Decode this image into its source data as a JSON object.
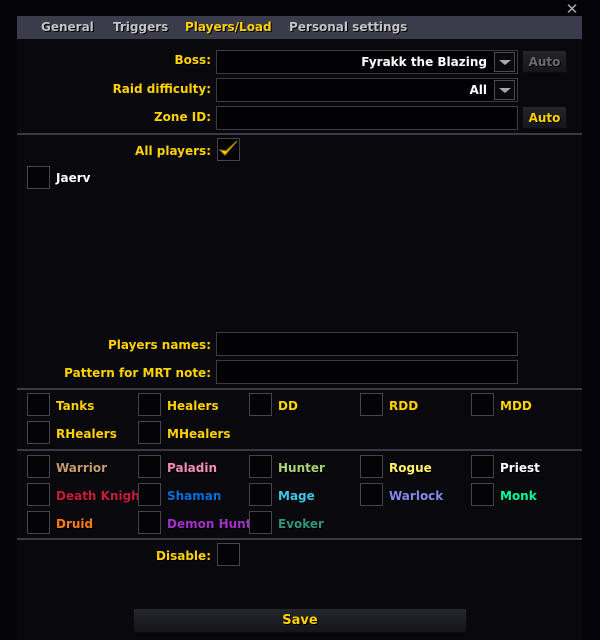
{
  "window": {
    "close_icon": "✕"
  },
  "tabs": [
    {
      "label": "General",
      "active": false
    },
    {
      "label": "Triggers",
      "active": false
    },
    {
      "label": "Players/Load",
      "active": true
    },
    {
      "label": "Personal settings",
      "active": false
    }
  ],
  "boss": {
    "label": "Boss:",
    "value": "Fyrakk the Blazing",
    "auto_label": "Auto",
    "auto_enabled": false
  },
  "difficulty": {
    "label": "Raid difficulty:",
    "value": "All"
  },
  "zone": {
    "label": "Zone ID:",
    "value": "",
    "auto_label": "Auto",
    "auto_enabled": true
  },
  "all_players": {
    "label": "All players:",
    "checked": true
  },
  "players": [
    {
      "name": "Jaerv",
      "checked": false
    }
  ],
  "players_names": {
    "label": "Players names:",
    "value": ""
  },
  "mrt_pattern": {
    "label": "Pattern for MRT note:",
    "value": ""
  },
  "roles": [
    {
      "label": "Tanks",
      "checked": false
    },
    {
      "label": "Healers",
      "checked": false
    },
    {
      "label": "DD",
      "checked": false
    },
    {
      "label": "RDD",
      "checked": false
    },
    {
      "label": "MDD",
      "checked": false
    },
    {
      "label": "RHealers",
      "checked": false
    },
    {
      "label": "MHealers",
      "checked": false
    }
  ],
  "classes": [
    {
      "label": "Warrior",
      "color": "#c69b6d",
      "checked": false
    },
    {
      "label": "Paladin",
      "color": "#f48cba",
      "checked": false
    },
    {
      "label": "Hunter",
      "color": "#aad372",
      "checked": false
    },
    {
      "label": "Rogue",
      "color": "#fff468",
      "checked": false
    },
    {
      "label": "Priest",
      "color": "#ffffff",
      "checked": false
    },
    {
      "label": "Death Knight",
      "color": "#c41e3b",
      "checked": false
    },
    {
      "label": "Shaman",
      "color": "#0070dd",
      "checked": false
    },
    {
      "label": "Mage",
      "color": "#3fc7eb",
      "checked": false
    },
    {
      "label": "Warlock",
      "color": "#8788ee",
      "checked": false
    },
    {
      "label": "Monk",
      "color": "#00ff98",
      "checked": false
    },
    {
      "label": "Druid",
      "color": "#ff7c0a",
      "checked": false
    },
    {
      "label": "Demon Hunter",
      "color": "#a330c9",
      "checked": false
    },
    {
      "label": "Evoker",
      "color": "#33937f",
      "checked": false
    }
  ],
  "disable": {
    "label": "Disable:",
    "checked": false
  },
  "save_label": "Save"
}
